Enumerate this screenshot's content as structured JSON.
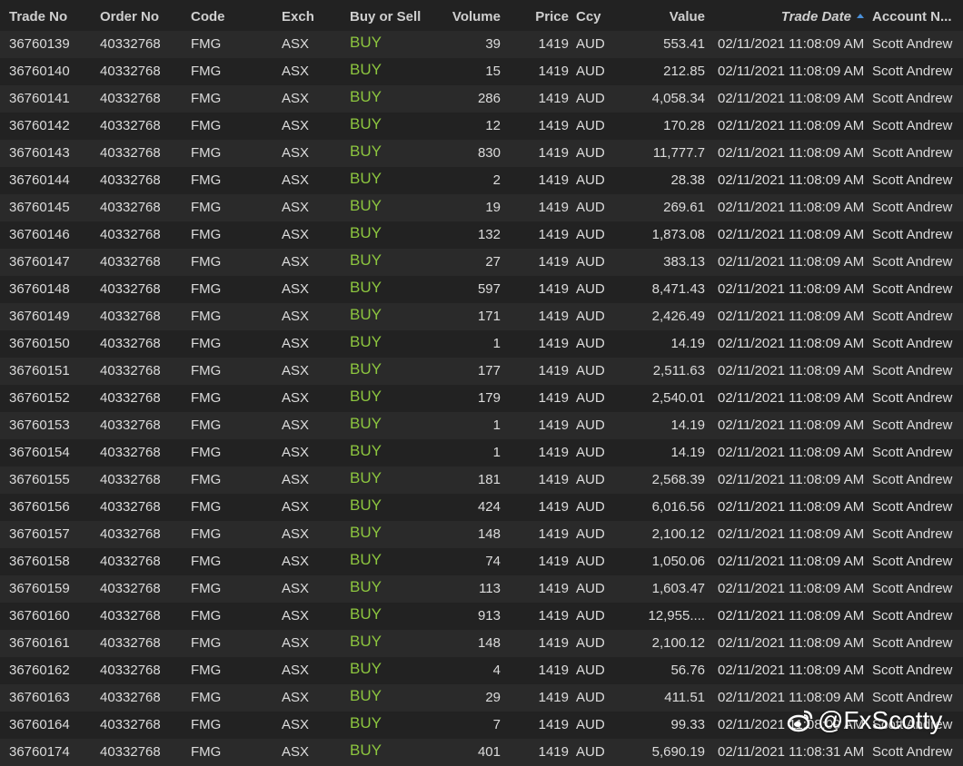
{
  "colors": {
    "background": "#222222",
    "row_alt": "#2a2a2a",
    "text": "#dcdcdc",
    "buy": "#8dc63f",
    "sort_arrow": "#4a90d9"
  },
  "columns": {
    "trade_no": "Trade No",
    "order_no": "Order No",
    "code": "Code",
    "exch": "Exch",
    "side": "Buy or Sell",
    "volume": "Volume",
    "price": "Price",
    "ccy": "Ccy",
    "value": "Value",
    "trade_date": "Trade Date",
    "account": "Account N..."
  },
  "sort": {
    "column": "trade_date",
    "direction": "ascending",
    "icon": "sort-ascending-icon"
  },
  "rows": [
    {
      "trade_no": "36760139",
      "order_no": "40332768",
      "code": "FMG",
      "exch": "ASX",
      "side": "BUY",
      "volume": "39",
      "price": "1419",
      "ccy": "AUD",
      "value": "553.41",
      "trade_date": "02/11/2021 11:08:09 AM",
      "account": "Scott Andrew"
    },
    {
      "trade_no": "36760140",
      "order_no": "40332768",
      "code": "FMG",
      "exch": "ASX",
      "side": "BUY",
      "volume": "15",
      "price": "1419",
      "ccy": "AUD",
      "value": "212.85",
      "trade_date": "02/11/2021 11:08:09 AM",
      "account": "Scott Andrew"
    },
    {
      "trade_no": "36760141",
      "order_no": "40332768",
      "code": "FMG",
      "exch": "ASX",
      "side": "BUY",
      "volume": "286",
      "price": "1419",
      "ccy": "AUD",
      "value": "4,058.34",
      "trade_date": "02/11/2021 11:08:09 AM",
      "account": "Scott Andrew"
    },
    {
      "trade_no": "36760142",
      "order_no": "40332768",
      "code": "FMG",
      "exch": "ASX",
      "side": "BUY",
      "volume": "12",
      "price": "1419",
      "ccy": "AUD",
      "value": "170.28",
      "trade_date": "02/11/2021 11:08:09 AM",
      "account": "Scott Andrew"
    },
    {
      "trade_no": "36760143",
      "order_no": "40332768",
      "code": "FMG",
      "exch": "ASX",
      "side": "BUY",
      "volume": "830",
      "price": "1419",
      "ccy": "AUD",
      "value": "11,777.7",
      "trade_date": "02/11/2021 11:08:09 AM",
      "account": "Scott Andrew"
    },
    {
      "trade_no": "36760144",
      "order_no": "40332768",
      "code": "FMG",
      "exch": "ASX",
      "side": "BUY",
      "volume": "2",
      "price": "1419",
      "ccy": "AUD",
      "value": "28.38",
      "trade_date": "02/11/2021 11:08:09 AM",
      "account": "Scott Andrew"
    },
    {
      "trade_no": "36760145",
      "order_no": "40332768",
      "code": "FMG",
      "exch": "ASX",
      "side": "BUY",
      "volume": "19",
      "price": "1419",
      "ccy": "AUD",
      "value": "269.61",
      "trade_date": "02/11/2021 11:08:09 AM",
      "account": "Scott Andrew"
    },
    {
      "trade_no": "36760146",
      "order_no": "40332768",
      "code": "FMG",
      "exch": "ASX",
      "side": "BUY",
      "volume": "132",
      "price": "1419",
      "ccy": "AUD",
      "value": "1,873.08",
      "trade_date": "02/11/2021 11:08:09 AM",
      "account": "Scott Andrew"
    },
    {
      "trade_no": "36760147",
      "order_no": "40332768",
      "code": "FMG",
      "exch": "ASX",
      "side": "BUY",
      "volume": "27",
      "price": "1419",
      "ccy": "AUD",
      "value": "383.13",
      "trade_date": "02/11/2021 11:08:09 AM",
      "account": "Scott Andrew"
    },
    {
      "trade_no": "36760148",
      "order_no": "40332768",
      "code": "FMG",
      "exch": "ASX",
      "side": "BUY",
      "volume": "597",
      "price": "1419",
      "ccy": "AUD",
      "value": "8,471.43",
      "trade_date": "02/11/2021 11:08:09 AM",
      "account": "Scott Andrew"
    },
    {
      "trade_no": "36760149",
      "order_no": "40332768",
      "code": "FMG",
      "exch": "ASX",
      "side": "BUY",
      "volume": "171",
      "price": "1419",
      "ccy": "AUD",
      "value": "2,426.49",
      "trade_date": "02/11/2021 11:08:09 AM",
      "account": "Scott Andrew"
    },
    {
      "trade_no": "36760150",
      "order_no": "40332768",
      "code": "FMG",
      "exch": "ASX",
      "side": "BUY",
      "volume": "1",
      "price": "1419",
      "ccy": "AUD",
      "value": "14.19",
      "trade_date": "02/11/2021 11:08:09 AM",
      "account": "Scott Andrew"
    },
    {
      "trade_no": "36760151",
      "order_no": "40332768",
      "code": "FMG",
      "exch": "ASX",
      "side": "BUY",
      "volume": "177",
      "price": "1419",
      "ccy": "AUD",
      "value": "2,511.63",
      "trade_date": "02/11/2021 11:08:09 AM",
      "account": "Scott Andrew"
    },
    {
      "trade_no": "36760152",
      "order_no": "40332768",
      "code": "FMG",
      "exch": "ASX",
      "side": "BUY",
      "volume": "179",
      "price": "1419",
      "ccy": "AUD",
      "value": "2,540.01",
      "trade_date": "02/11/2021 11:08:09 AM",
      "account": "Scott Andrew"
    },
    {
      "trade_no": "36760153",
      "order_no": "40332768",
      "code": "FMG",
      "exch": "ASX",
      "side": "BUY",
      "volume": "1",
      "price": "1419",
      "ccy": "AUD",
      "value": "14.19",
      "trade_date": "02/11/2021 11:08:09 AM",
      "account": "Scott Andrew"
    },
    {
      "trade_no": "36760154",
      "order_no": "40332768",
      "code": "FMG",
      "exch": "ASX",
      "side": "BUY",
      "volume": "1",
      "price": "1419",
      "ccy": "AUD",
      "value": "14.19",
      "trade_date": "02/11/2021 11:08:09 AM",
      "account": "Scott Andrew"
    },
    {
      "trade_no": "36760155",
      "order_no": "40332768",
      "code": "FMG",
      "exch": "ASX",
      "side": "BUY",
      "volume": "181",
      "price": "1419",
      "ccy": "AUD",
      "value": "2,568.39",
      "trade_date": "02/11/2021 11:08:09 AM",
      "account": "Scott Andrew"
    },
    {
      "trade_no": "36760156",
      "order_no": "40332768",
      "code": "FMG",
      "exch": "ASX",
      "side": "BUY",
      "volume": "424",
      "price": "1419",
      "ccy": "AUD",
      "value": "6,016.56",
      "trade_date": "02/11/2021 11:08:09 AM",
      "account": "Scott Andrew"
    },
    {
      "trade_no": "36760157",
      "order_no": "40332768",
      "code": "FMG",
      "exch": "ASX",
      "side": "BUY",
      "volume": "148",
      "price": "1419",
      "ccy": "AUD",
      "value": "2,100.12",
      "trade_date": "02/11/2021 11:08:09 AM",
      "account": "Scott Andrew"
    },
    {
      "trade_no": "36760158",
      "order_no": "40332768",
      "code": "FMG",
      "exch": "ASX",
      "side": "BUY",
      "volume": "74",
      "price": "1419",
      "ccy": "AUD",
      "value": "1,050.06",
      "trade_date": "02/11/2021 11:08:09 AM",
      "account": "Scott Andrew"
    },
    {
      "trade_no": "36760159",
      "order_no": "40332768",
      "code": "FMG",
      "exch": "ASX",
      "side": "BUY",
      "volume": "113",
      "price": "1419",
      "ccy": "AUD",
      "value": "1,603.47",
      "trade_date": "02/11/2021 11:08:09 AM",
      "account": "Scott Andrew"
    },
    {
      "trade_no": "36760160",
      "order_no": "40332768",
      "code": "FMG",
      "exch": "ASX",
      "side": "BUY",
      "volume": "913",
      "price": "1419",
      "ccy": "AUD",
      "value": "12,955....",
      "trade_date": "02/11/2021 11:08:09 AM",
      "account": "Scott Andrew"
    },
    {
      "trade_no": "36760161",
      "order_no": "40332768",
      "code": "FMG",
      "exch": "ASX",
      "side": "BUY",
      "volume": "148",
      "price": "1419",
      "ccy": "AUD",
      "value": "2,100.12",
      "trade_date": "02/11/2021 11:08:09 AM",
      "account": "Scott Andrew"
    },
    {
      "trade_no": "36760162",
      "order_no": "40332768",
      "code": "FMG",
      "exch": "ASX",
      "side": "BUY",
      "volume": "4",
      "price": "1419",
      "ccy": "AUD",
      "value": "56.76",
      "trade_date": "02/11/2021 11:08:09 AM",
      "account": "Scott Andrew"
    },
    {
      "trade_no": "36760163",
      "order_no": "40332768",
      "code": "FMG",
      "exch": "ASX",
      "side": "BUY",
      "volume": "29",
      "price": "1419",
      "ccy": "AUD",
      "value": "411.51",
      "trade_date": "02/11/2021 11:08:09 AM",
      "account": "Scott Andrew"
    },
    {
      "trade_no": "36760164",
      "order_no": "40332768",
      "code": "FMG",
      "exch": "ASX",
      "side": "BUY",
      "volume": "7",
      "price": "1419",
      "ccy": "AUD",
      "value": "99.33",
      "trade_date": "02/11/2021 11:08:09 AM",
      "account": "Scott Andrew"
    },
    {
      "trade_no": "36760174",
      "order_no": "40332768",
      "code": "FMG",
      "exch": "ASX",
      "side": "BUY",
      "volume": "401",
      "price": "1419",
      "ccy": "AUD",
      "value": "5,690.19",
      "trade_date": "02/11/2021 11:08:31 AM",
      "account": "Scott Andrew"
    }
  ],
  "watermark": {
    "text": "@FxScotty",
    "icon": "weibo-logo-icon"
  }
}
